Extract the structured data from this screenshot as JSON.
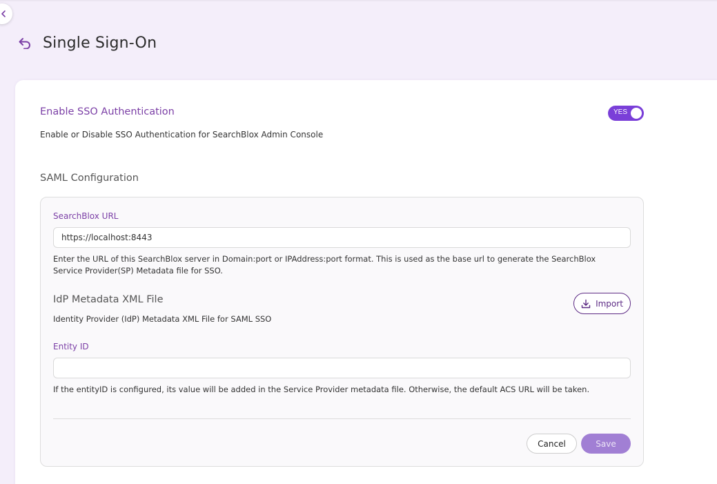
{
  "page": {
    "title": "Single Sign-On"
  },
  "sso": {
    "title": "Enable SSO Authentication",
    "description": "Enable or Disable SSO Authentication for SearchBlox Admin Console",
    "toggle_label": "YES",
    "enabled": true
  },
  "saml": {
    "heading": "SAML Configuration",
    "url_label": "SearchBlox URL",
    "url_value": "https://localhost:8443",
    "url_help": "Enter the URL of this SearchBlox server in Domain:port or IPAddress:port format. This is used as the base url to generate the SearchBlox Service Provider(SP) Metadata file for SSO.",
    "idp_title": "IdP Metadata XML File",
    "idp_desc": "Identity Provider (IdP) Metadata XML File for SAML SSO",
    "import_label": "Import",
    "entity_label": "Entity ID",
    "entity_value": "",
    "entity_help": "If the entityID is configured, its value will be added in the Service Provider metadata file. Otherwise, the default ACS URL will be taken."
  },
  "actions": {
    "cancel_label": "Cancel",
    "save_label": "Save"
  },
  "colors": {
    "accent": "#7b3fa6",
    "toggle": "#7a3fd8",
    "save_disabled": "#a17fd4",
    "background": "#f4eefa"
  }
}
